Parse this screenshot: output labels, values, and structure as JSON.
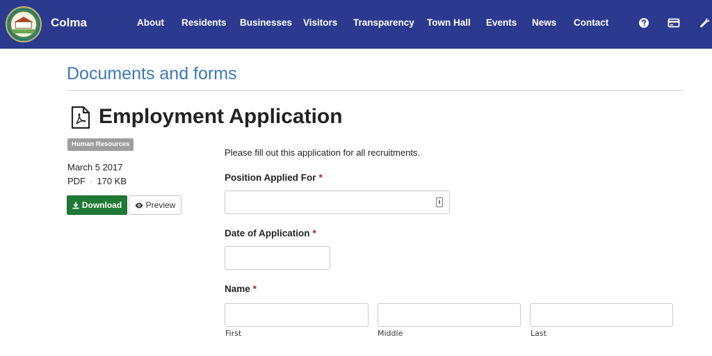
{
  "header": {
    "brand": "Colma",
    "nav": [
      "About",
      "Residents",
      "Businesses",
      "Visitors",
      "Transparency",
      "Town Hall",
      "Events",
      "News",
      "Contact"
    ],
    "icons": [
      "help-icon",
      "credit-card-icon",
      "wrench-icon"
    ]
  },
  "page": {
    "section_title": "Documents and forms",
    "doc_title": "Employment Application",
    "doc_icon": "pdf-file-icon"
  },
  "meta": {
    "category": "Human Resources",
    "date": "March 5 2017",
    "file_type": "PDF",
    "separator": "·",
    "file_size": "170 KB",
    "download_label": "Download",
    "preview_label": "Preview"
  },
  "form": {
    "intro": "Please fill out this application for all recruitments.",
    "required_mark": "*",
    "position_label": "Position Applied For",
    "position_value": "",
    "date_label": "Date of Application",
    "date_value": "",
    "name_label": "Name",
    "name_first": "First",
    "name_middle": "Middle",
    "name_last": "Last"
  },
  "colors": {
    "header_bg": "#2b3a8f",
    "section_title": "#3a78b8",
    "download_bg": "#1e7a35",
    "badge_bg": "#9e9e9e",
    "required": "#b01e2a"
  }
}
